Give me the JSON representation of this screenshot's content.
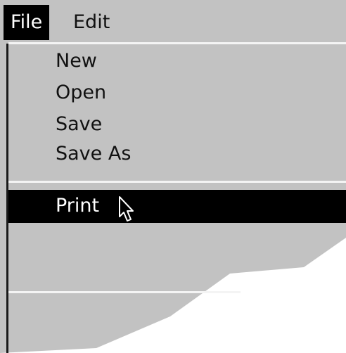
{
  "menu_bar": {
    "items": [
      {
        "label": "File",
        "state": "open"
      },
      {
        "label": "Edit",
        "state": "closed"
      }
    ]
  },
  "file_menu": {
    "items": [
      {
        "label": "New"
      },
      {
        "label": "Open"
      },
      {
        "label": "Save"
      },
      {
        "label": "Save As"
      },
      {
        "label": "Print",
        "highlighted": true
      }
    ]
  },
  "icons": {
    "pointer": "arrow-cursor-icon"
  },
  "colors": {
    "menu_background": "#c2c2c2",
    "highlight_background": "#000000",
    "highlight_text": "#ffffff",
    "text": "#111111",
    "separator": "#f4f4f4"
  }
}
